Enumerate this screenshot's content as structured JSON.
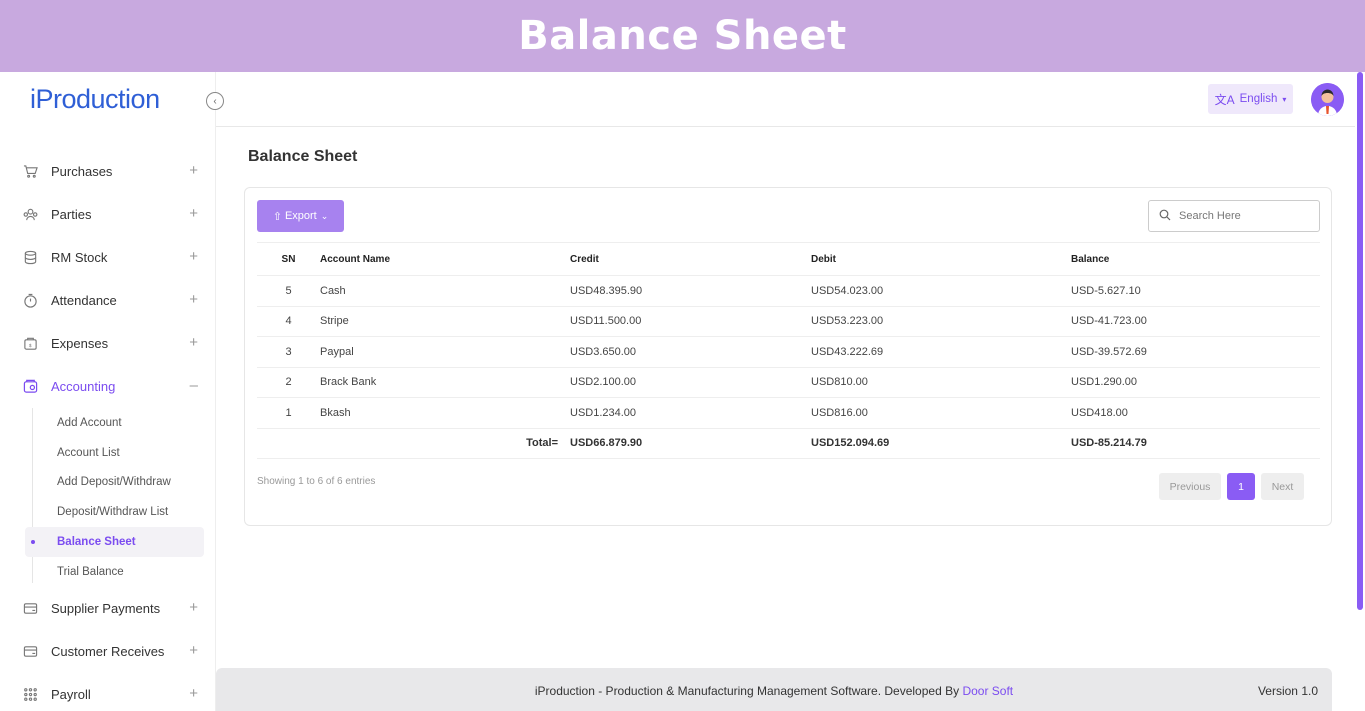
{
  "banner": {
    "title": "Balance Sheet"
  },
  "app": {
    "logo": "iProduction"
  },
  "topbar": {
    "language": "English"
  },
  "sidebar": {
    "items": [
      {
        "label": "Purchases",
        "icon": "cart-icon"
      },
      {
        "label": "Parties",
        "icon": "users-icon"
      },
      {
        "label": "RM Stock",
        "icon": "database-icon"
      },
      {
        "label": "Attendance",
        "icon": "clock-icon"
      },
      {
        "label": "Expenses",
        "icon": "wallet-icon"
      },
      {
        "label": "Accounting",
        "icon": "accounting-icon"
      }
    ],
    "accounting_sub": [
      {
        "label": "Add Account"
      },
      {
        "label": "Account List"
      },
      {
        "label": "Add Deposit/Withdraw"
      },
      {
        "label": "Deposit/Withdraw List"
      },
      {
        "label": "Balance Sheet"
      },
      {
        "label": "Trial Balance"
      }
    ],
    "items_after": [
      {
        "label": "Supplier Payments",
        "icon": "card-icon"
      },
      {
        "label": "Customer Receives",
        "icon": "card-icon"
      },
      {
        "label": "Payroll",
        "icon": "grid-icon"
      }
    ]
  },
  "page": {
    "title": "Balance Sheet"
  },
  "toolbar": {
    "export_label": "Export",
    "search_placeholder": "Search Here"
  },
  "table": {
    "headers": {
      "sn": "SN",
      "account": "Account Name",
      "credit": "Credit",
      "debit": "Debit",
      "balance": "Balance"
    },
    "rows": [
      {
        "sn": "5",
        "account": "Cash",
        "credit": "USD48.395.90",
        "debit": "USD54.023.00",
        "balance": "USD-5.627.10"
      },
      {
        "sn": "4",
        "account": "Stripe",
        "credit": "USD11.500.00",
        "debit": "USD53.223.00",
        "balance": "USD-41.723.00"
      },
      {
        "sn": "3",
        "account": "Paypal",
        "credit": "USD3.650.00",
        "debit": "USD43.222.69",
        "balance": "USD-39.572.69"
      },
      {
        "sn": "2",
        "account": "Brack Bank",
        "credit": "USD2.100.00",
        "debit": "USD810.00",
        "balance": "USD1.290.00"
      },
      {
        "sn": "1",
        "account": "Bkash",
        "credit": "USD1.234.00",
        "debit": "USD816.00",
        "balance": "USD418.00"
      }
    ],
    "total": {
      "label": "Total=",
      "credit": "USD66.879.90",
      "debit": "USD152.094.69",
      "balance": "USD-85.214.79"
    }
  },
  "pagination": {
    "info": "Showing 1 to 6 of 6 entries",
    "previous": "Previous",
    "current": "1",
    "next": "Next"
  },
  "footer": {
    "text": "iProduction - Production & Manufacturing Management Software. Developed By",
    "link": "Door Soft",
    "version": "Version 1.0"
  },
  "colors": {
    "banner": "#c8a9df",
    "accent": "#7b4cf0",
    "logo": "#2f5fd6"
  }
}
